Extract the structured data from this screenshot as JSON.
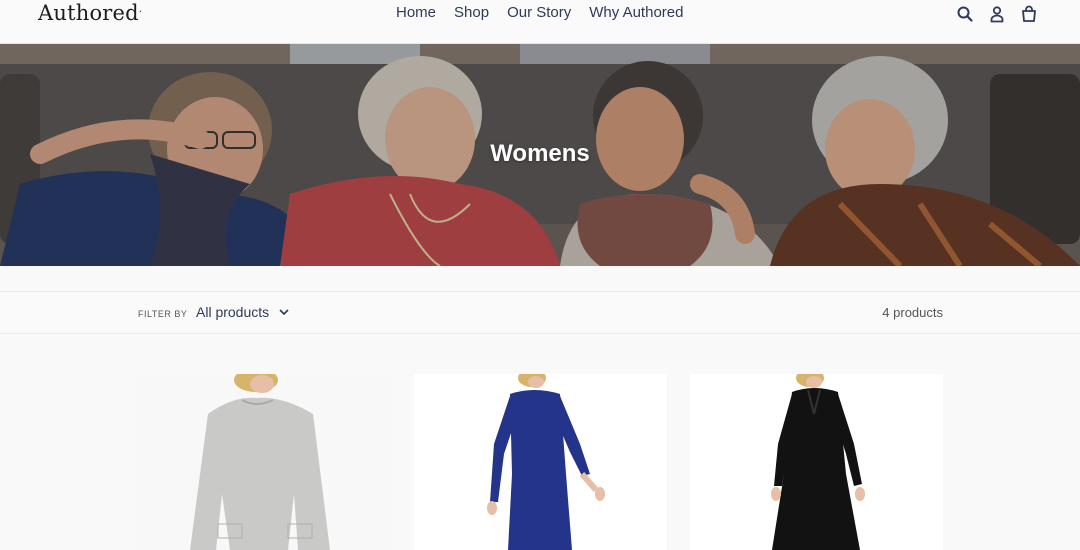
{
  "header": {
    "logo": "Authored",
    "logo_mark": ".",
    "nav": [
      "Home",
      "Shop",
      "Our Story",
      "Why Authored"
    ],
    "icons": [
      "search-icon",
      "account-icon",
      "cart-icon"
    ]
  },
  "hero": {
    "title": "Womens"
  },
  "filter": {
    "label": "FILTER BY",
    "selected": "All products",
    "count": "4 products"
  },
  "products": [
    {
      "image": "grey-sweatshirt-dress",
      "color": "#c9c9c7"
    },
    {
      "image": "navy-knit-dress",
      "color": "#23348a"
    },
    {
      "image": "black-polo-dress",
      "color": "#121212"
    }
  ],
  "colors": {
    "nav_text": "#2e3a5a",
    "background": "#f9f9f9"
  }
}
